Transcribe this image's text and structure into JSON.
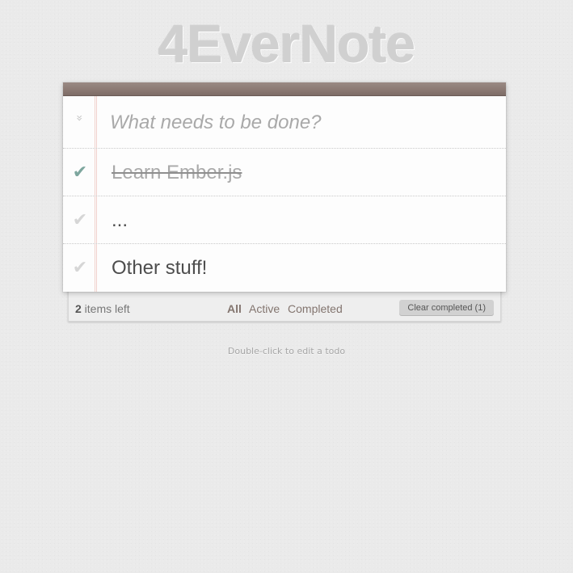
{
  "app": {
    "title": "4EverNote"
  },
  "new_todo": {
    "placeholder": "What needs to be done?",
    "value": ""
  },
  "toggle_all": {
    "glyph": "»"
  },
  "todos": [
    {
      "label": "Learn Ember.js",
      "completed": true,
      "check_glyph": "✔"
    },
    {
      "label": "...",
      "completed": false,
      "check_glyph": "✔"
    },
    {
      "label": "Other stuff!",
      "completed": false,
      "check_glyph": "✔"
    }
  ],
  "footer": {
    "count": "2",
    "count_suffix": " items left",
    "filters": {
      "all": "All",
      "active": "Active",
      "completed": "Completed"
    },
    "selected_filter": "All",
    "clear_label": "Clear completed (1)"
  },
  "info": {
    "hint": "Double-click to edit a todo"
  },
  "colors": {
    "header_bar": "#8a7872",
    "check_done": "#7da69e",
    "check_pending": "#d6d6d6",
    "filter_link": "#83756f",
    "margin_line": "#f1d2cd"
  },
  "icons": {
    "toggle_all": "double-chevron-down-icon",
    "check": "checkmark-icon"
  }
}
